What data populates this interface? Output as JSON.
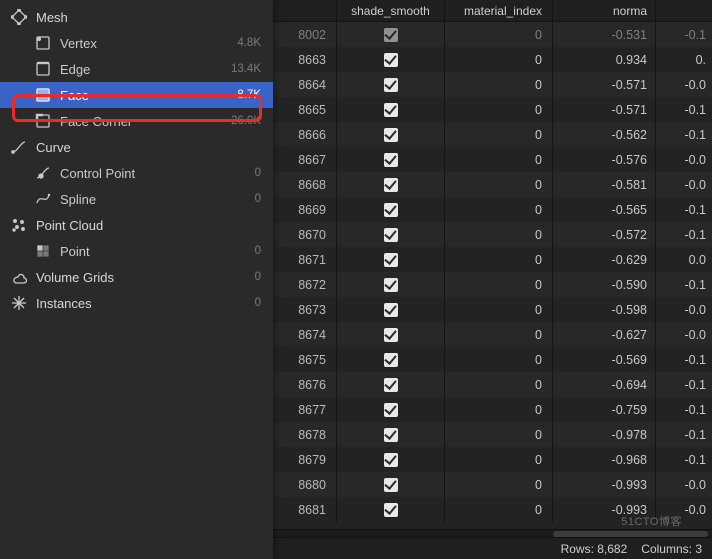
{
  "sidebar": {
    "mesh": {
      "label": "Mesh",
      "vertex": {
        "label": "Vertex",
        "count": "4.8K"
      },
      "edge": {
        "label": "Edge",
        "count": "13.4K"
      },
      "face": {
        "label": "Face",
        "count": "8.7K"
      },
      "corner": {
        "label": "Face Corner",
        "count": "26.0K"
      }
    },
    "curve": {
      "label": "Curve",
      "cp": {
        "label": "Control Point",
        "count": "0"
      },
      "spline": {
        "label": "Spline",
        "count": "0"
      }
    },
    "pointcloud": {
      "label": "Point Cloud",
      "point": {
        "label": "Point",
        "count": "0"
      }
    },
    "volumegrids": {
      "label": "Volume Grids",
      "count": "0"
    },
    "instances": {
      "label": "Instances",
      "count": "0"
    }
  },
  "columns": {
    "shade_smooth": "shade_smooth",
    "material_index": "material_index",
    "normal": "norma"
  },
  "rows": [
    {
      "idx": "8002",
      "ss": true,
      "mi": "0",
      "nx": "-0.531",
      "ny": "-0.1"
    },
    {
      "idx": "8663",
      "ss": true,
      "mi": "0",
      "nx": "0.934",
      "ny": "0."
    },
    {
      "idx": "8664",
      "ss": true,
      "mi": "0",
      "nx": "-0.571",
      "ny": "-0.0"
    },
    {
      "idx": "8665",
      "ss": true,
      "mi": "0",
      "nx": "-0.571",
      "ny": "-0.1"
    },
    {
      "idx": "8666",
      "ss": true,
      "mi": "0",
      "nx": "-0.562",
      "ny": "-0.1"
    },
    {
      "idx": "8667",
      "ss": true,
      "mi": "0",
      "nx": "-0.576",
      "ny": "-0.0"
    },
    {
      "idx": "8668",
      "ss": true,
      "mi": "0",
      "nx": "-0.581",
      "ny": "-0.0"
    },
    {
      "idx": "8669",
      "ss": true,
      "mi": "0",
      "nx": "-0.565",
      "ny": "-0.1"
    },
    {
      "idx": "8670",
      "ss": true,
      "mi": "0",
      "nx": "-0.572",
      "ny": "-0.1"
    },
    {
      "idx": "8671",
      "ss": true,
      "mi": "0",
      "nx": "-0.629",
      "ny": "0.0"
    },
    {
      "idx": "8672",
      "ss": true,
      "mi": "0",
      "nx": "-0.590",
      "ny": "-0.1"
    },
    {
      "idx": "8673",
      "ss": true,
      "mi": "0",
      "nx": "-0.598",
      "ny": "-0.0"
    },
    {
      "idx": "8674",
      "ss": true,
      "mi": "0",
      "nx": "-0.627",
      "ny": "-0.0"
    },
    {
      "idx": "8675",
      "ss": true,
      "mi": "0",
      "nx": "-0.569",
      "ny": "-0.1"
    },
    {
      "idx": "8676",
      "ss": true,
      "mi": "0",
      "nx": "-0.694",
      "ny": "-0.1"
    },
    {
      "idx": "8677",
      "ss": true,
      "mi": "0",
      "nx": "-0.759",
      "ny": "-0.1"
    },
    {
      "idx": "8678",
      "ss": true,
      "mi": "0",
      "nx": "-0.978",
      "ny": "-0.1"
    },
    {
      "idx": "8679",
      "ss": true,
      "mi": "0",
      "nx": "-0.968",
      "ny": "-0.1"
    },
    {
      "idx": "8680",
      "ss": true,
      "mi": "0",
      "nx": "-0.993",
      "ny": "-0.0"
    },
    {
      "idx": "8681",
      "ss": true,
      "mi": "0",
      "nx": "-0.993",
      "ny": "-0.0"
    }
  ],
  "status": {
    "rows_label": "Rows:",
    "rows_value": "8,682",
    "cols_label": "Columns:",
    "cols_value": "3"
  },
  "watermark": "51CTO博客"
}
